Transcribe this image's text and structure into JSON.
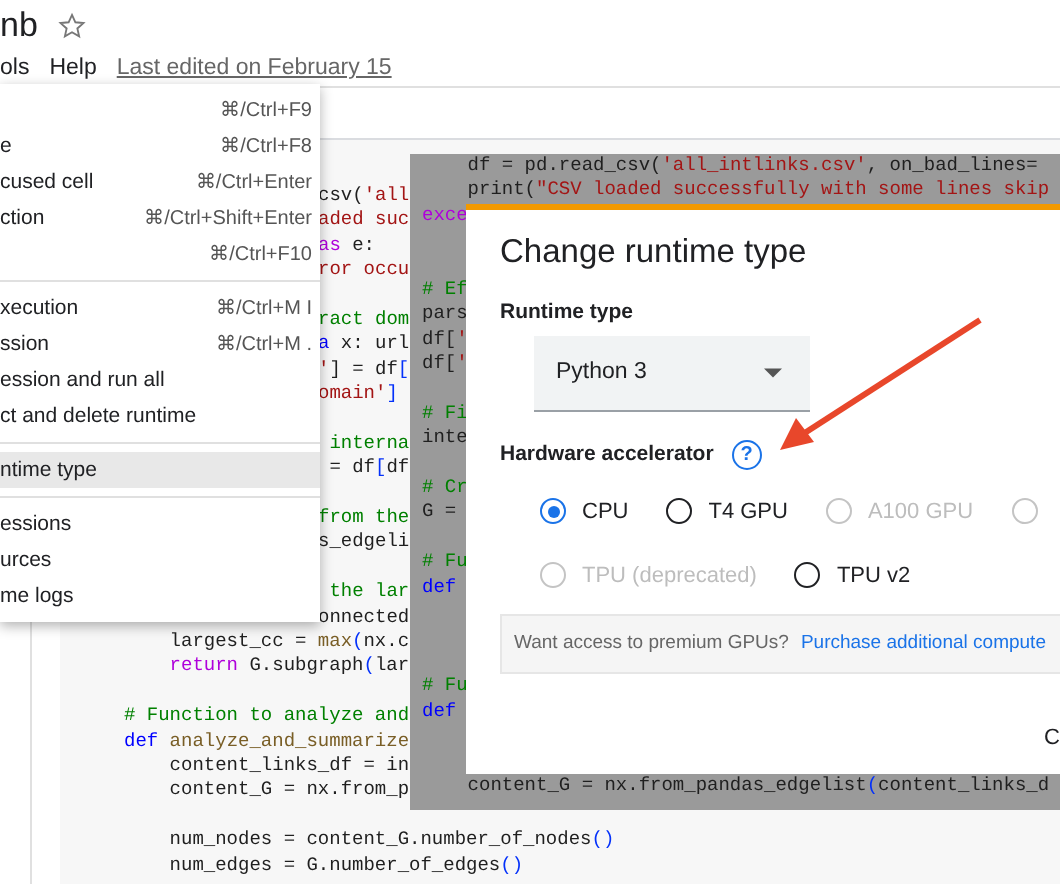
{
  "header": {
    "title": "nb",
    "starred": false,
    "menus": [
      "ols",
      "Help"
    ],
    "last_edited": "Last edited on February 15"
  },
  "dropdown_menu": {
    "groups": [
      [
        {
          "shortcut": "⌘/Ctrl+F9",
          "selected": false
        },
        {
          "label": "e",
          "shortcut": "⌘/Ctrl+F8",
          "selected": false
        },
        {
          "label": "cused cell",
          "shortcut": "⌘/Ctrl+Enter",
          "selected": false
        },
        {
          "label": "ction",
          "shortcut": "⌘/Ctrl+Shift+Enter",
          "selected": false
        },
        {
          "shortcut": "⌘/Ctrl+F10",
          "selected": false
        }
      ],
      [
        {
          "label": "xecution",
          "shortcut": "⌘/Ctrl+M I",
          "selected": false
        },
        {
          "label": "ssion",
          "shortcut": "⌘/Ctrl+M .",
          "selected": false
        },
        {
          "label": "ession and run all",
          "selected": false
        },
        {
          "label": "ct and delete runtime",
          "selected": false
        }
      ],
      [
        {
          "label": "ntime type",
          "selected": true
        }
      ],
      [
        {
          "label": "essions",
          "selected": false
        },
        {
          "label": "urces",
          "selected": false
        },
        {
          "label": "me logs",
          "selected": false
        }
      ]
    ]
  },
  "code": {
    "fragments": [
      {
        "kind": "code",
        "segments": [
          {
            "text": "csv(",
            "kind": "plain"
          },
          {
            "text": "'all",
            "kind": "string"
          }
        ]
      },
      {
        "kind": "code",
        "segments": [
          {
            "text": "aded suc",
            "kind": "string"
          }
        ]
      },
      {
        "kind": "code",
        "segments": [
          {
            "text": "as",
            "kind": "keyword"
          },
          {
            "text": " e:",
            "kind": "plain"
          }
        ]
      },
      {
        "kind": "code",
        "segments": [
          {
            "text": "ror occu",
            "kind": "string"
          }
        ]
      },
      {
        "kind": "blank"
      },
      {
        "kind": "code",
        "segments": [
          {
            "text": "ract dom",
            "kind": "comment"
          }
        ]
      },
      {
        "kind": "code",
        "segments": [
          {
            "text": "a",
            "kind": "def"
          },
          {
            "text": " x: url",
            "kind": "plain"
          }
        ]
      },
      {
        "kind": "code",
        "segments": [
          {
            "text": "'",
            "kind": "string"
          },
          {
            "text": "] = df",
            "kind": "plain"
          },
          {
            "text": "[",
            "kind": "bracket"
          }
        ]
      },
      {
        "kind": "code",
        "segments": [
          {
            "text": "omain'",
            "kind": "string"
          },
          {
            "text": "]",
            "kind": "bracket"
          }
        ]
      },
      {
        "kind": "blank"
      },
      {
        "kind": "code",
        "segments": [
          {
            "text": " interna",
            "kind": "comment"
          }
        ]
      },
      {
        "kind": "code",
        "segments": [
          {
            "text": " = df",
            "kind": "plain"
          },
          {
            "text": "[",
            "kind": "bracket"
          },
          {
            "text": "df",
            "kind": "plain"
          }
        ]
      },
      {
        "kind": "blank"
      },
      {
        "kind": "code",
        "segments": [
          {
            "text": "from the",
            "kind": "comment"
          }
        ]
      },
      {
        "kind": "code",
        "segments": [
          {
            "text": "s_edgeli",
            "kind": "plain"
          }
        ]
      },
      {
        "kind": "blank"
      },
      {
        "kind": "code",
        "segments": [
          {
            "text": " the lar",
            "kind": "comment"
          }
        ]
      },
      {
        "kind": "code",
        "segments": [
          {
            "text": "onnected",
            "kind": "plain"
          }
        ]
      }
    ],
    "lines": [
      {
        "kind": "code",
        "segments": [
          {
            "text": "    largest_cc = ",
            "kind": "plain"
          },
          {
            "text": "max",
            "kind": "func"
          },
          {
            "text": "(",
            "kind": "bracket"
          },
          {
            "text": "nx.c",
            "kind": "plain"
          }
        ]
      },
      {
        "kind": "code",
        "segments": [
          {
            "text": "    return",
            "kind": "keyword"
          },
          {
            "text": " G.subgraph",
            "kind": "plain"
          },
          {
            "text": "(",
            "kind": "bracket"
          },
          {
            "text": "lar",
            "kind": "plain"
          }
        ]
      },
      {
        "kind": "blank"
      },
      {
        "kind": "code",
        "segments": [
          {
            "text": "# Function to analyze and",
            "kind": "comment"
          }
        ]
      },
      {
        "kind": "code",
        "segments": [
          {
            "text": "def",
            "kind": "def"
          },
          {
            "text": " analyze_and_summarize",
            "kind": "func"
          }
        ]
      },
      {
        "kind": "code",
        "segments": [
          {
            "text": "    content_links_df = in",
            "kind": "plain"
          }
        ]
      },
      {
        "kind": "code",
        "segments": [
          {
            "text": "    content_G = nx.from_p",
            "kind": "plain"
          }
        ]
      },
      {
        "kind": "blank"
      },
      {
        "kind": "code",
        "segments": [
          {
            "text": "    num_nodes = content_G.number_of_nodes",
            "kind": "plain"
          },
          {
            "text": "()",
            "kind": "bracket"
          }
        ]
      },
      {
        "kind": "code",
        "segments": [
          {
            "text": "    num_edges = G.number_of_edges",
            "kind": "plain"
          },
          {
            "text": "()",
            "kind": "bracket"
          }
        ]
      }
    ]
  },
  "inset": {
    "code_top": [
      {
        "kind": "code",
        "segments": [
          {
            "text": "    df = pd.read_csv(",
            "kind": "plain"
          },
          {
            "text": "'all_intlinks.csv'",
            "kind": "string"
          },
          {
            "text": ", on_bad_lines=",
            "kind": "plain"
          }
        ]
      },
      {
        "kind": "code",
        "segments": [
          {
            "text": "    print(",
            "kind": "plain"
          },
          {
            "text": "\"CSV loaded successfully with some lines skip",
            "kind": "string"
          }
        ]
      }
    ],
    "code_side": [
      {
        "kind": "code",
        "segments": [
          {
            "text": "exce",
            "kind": "keyword"
          }
        ]
      },
      {
        "kind": "blank"
      },
      {
        "kind": "blank"
      },
      {
        "kind": "code",
        "segments": [
          {
            "text": "# Ef",
            "kind": "comment"
          }
        ]
      },
      {
        "kind": "code",
        "segments": [
          {
            "text": "pars",
            "kind": "plain"
          }
        ]
      },
      {
        "kind": "code",
        "segments": [
          {
            "text": "df[",
            "kind": "plain"
          },
          {
            "text": "'",
            "kind": "string"
          }
        ]
      },
      {
        "kind": "code",
        "segments": [
          {
            "text": "df[",
            "kind": "plain"
          },
          {
            "text": "'",
            "kind": "string"
          }
        ]
      },
      {
        "kind": "blank"
      },
      {
        "kind": "code",
        "segments": [
          {
            "text": "# Fi",
            "kind": "comment"
          }
        ]
      },
      {
        "kind": "code",
        "segments": [
          {
            "text": "inte",
            "kind": "plain"
          }
        ]
      },
      {
        "kind": "blank"
      },
      {
        "kind": "code",
        "segments": [
          {
            "text": "# Cr",
            "kind": "comment"
          }
        ]
      },
      {
        "kind": "code",
        "segments": [
          {
            "text": "G =",
            "kind": "plain"
          }
        ]
      },
      {
        "kind": "blank"
      },
      {
        "kind": "code",
        "segments": [
          {
            "text": "# Fu",
            "kind": "comment"
          }
        ]
      },
      {
        "kind": "code",
        "segments": [
          {
            "text": "def",
            "kind": "def"
          }
        ]
      },
      {
        "kind": "blank"
      },
      {
        "kind": "blank"
      },
      {
        "kind": "blank"
      },
      {
        "kind": "code",
        "segments": [
          {
            "text": "# Fu",
            "kind": "comment"
          }
        ]
      },
      {
        "kind": "code",
        "segments": [
          {
            "text": "def",
            "kind": "def"
          }
        ]
      }
    ],
    "dialog": {
      "title": "Change runtime type",
      "runtime_label": "Runtime type",
      "runtime_value": "Python 3",
      "accelerator_label": "Hardware accelerator",
      "help_icon": "?",
      "option_rows": [
        [
          {
            "label": "CPU",
            "selected": true,
            "disabled": false
          },
          {
            "label": "T4 GPU",
            "selected": false,
            "disabled": false
          },
          {
            "label": "A100 GPU",
            "selected": false,
            "disabled": true
          },
          {
            "selected": false,
            "disabled": true
          }
        ],
        [
          {
            "label": "TPU (deprecated)",
            "selected": false,
            "disabled": true
          },
          {
            "label": "TPU v2",
            "selected": false,
            "disabled": false
          }
        ]
      ],
      "premium_text": "Want access to premium GPUs?",
      "premium_link": "Purchase additional compute",
      "buttons": [
        "C"
      ]
    },
    "code_bottom": [
      {
        "kind": "code",
        "segments": [
          {
            "text": "    content_G = nx.from_pandas_edgelist",
            "kind": "plain"
          },
          {
            "text": "(",
            "kind": "bracket"
          },
          {
            "text": "content_links_d",
            "kind": "plain"
          }
        ]
      }
    ]
  }
}
